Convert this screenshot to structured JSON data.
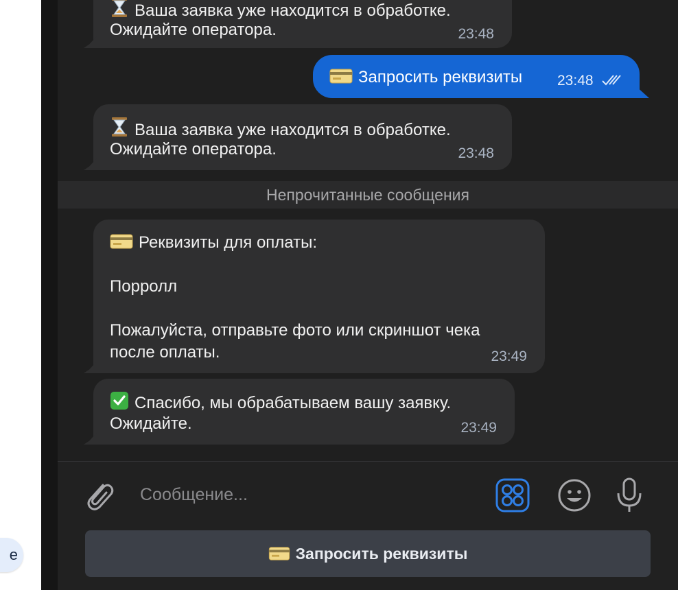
{
  "left_panel": {
    "chip_text": "e"
  },
  "messages": [
    {
      "id": "m1",
      "direction": "in",
      "icon": "hourglass-icon",
      "lines": [
        "Ваша заявка уже находится в обработке.",
        "Ожидайте оператора."
      ],
      "time": "23:48"
    },
    {
      "id": "m2",
      "direction": "out",
      "icon": "credit-card-icon",
      "lines": [
        "Запросить реквизиты"
      ],
      "time": "23:48",
      "status": "read"
    },
    {
      "id": "m3",
      "direction": "in",
      "icon": "hourglass-icon",
      "lines": [
        "Ваша заявка уже находится в обработке.",
        "Ожидайте оператора."
      ],
      "time": "23:48"
    },
    {
      "id": "m4",
      "direction": "in",
      "icon": "credit-card-icon",
      "lines": [
        "Реквизиты для оплаты:",
        "",
        "Порролл",
        "",
        "Пожалуйста, отправьте фото или скриншот чека",
        "после оплаты."
      ],
      "time": "23:49"
    },
    {
      "id": "m5",
      "direction": "in",
      "icon": "check-mark-icon",
      "lines": [
        "Спасибо, мы обрабатываем вашу заявку.",
        "Ожидайте."
      ],
      "time": "23:49"
    }
  ],
  "unread_divider": "Непрочитанные сообщения",
  "composer": {
    "placeholder": "Сообщение...",
    "quick_reply": "Запросить реквизиты"
  },
  "colors": {
    "chat_bg": "#1f1f1f",
    "bubble_in": "#2f2f30",
    "bubble_out": "#1566d4",
    "accent": "#2f7fe6"
  }
}
